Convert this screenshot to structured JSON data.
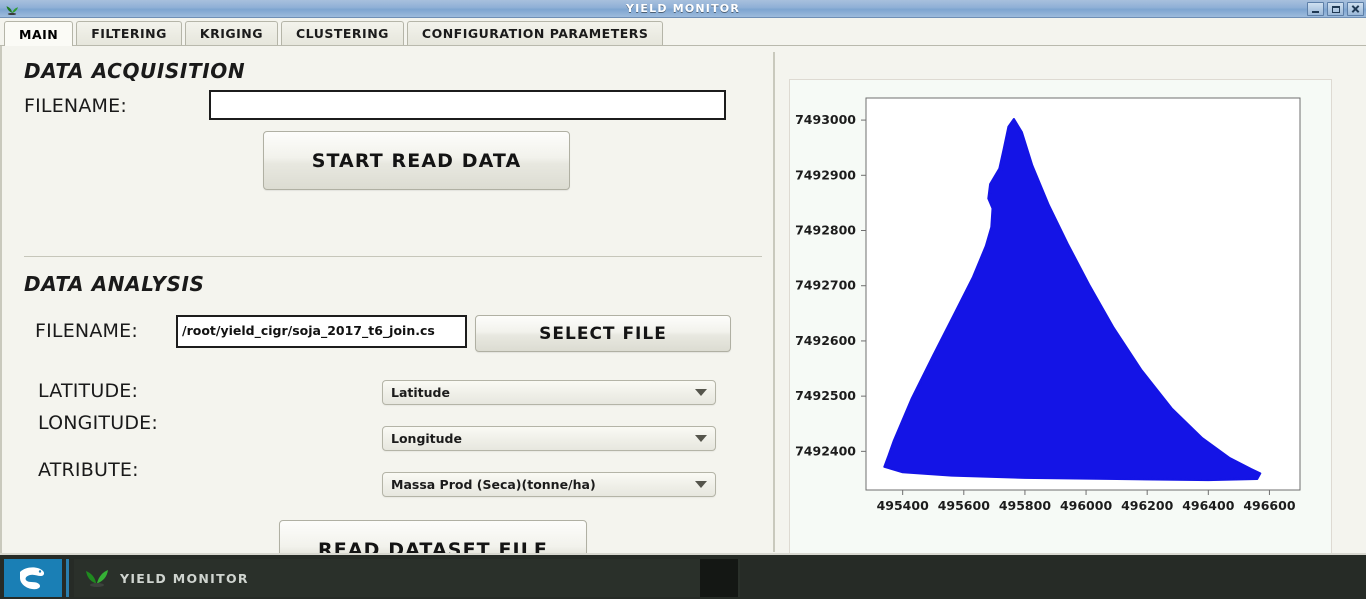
{
  "window": {
    "title": "YIELD MONITOR",
    "icon": "seedling-icon",
    "controls": [
      {
        "name": "minimize-button",
        "glyph": "minimize-icon"
      },
      {
        "name": "maximize-button",
        "glyph": "maximize-icon"
      },
      {
        "name": "close-button",
        "glyph": "close-icon"
      }
    ]
  },
  "tabs": [
    {
      "label": "MAIN",
      "active": true
    },
    {
      "label": "FILTERING",
      "active": false
    },
    {
      "label": "KRIGING",
      "active": false
    },
    {
      "label": "CLUSTERING",
      "active": false
    },
    {
      "label": "CONFIGURATION PARAMETERS",
      "active": false
    }
  ],
  "data_acquisition": {
    "heading": "DATA ACQUISITION",
    "filename_label": "FILENAME:",
    "filename_value": "",
    "filename_placeholder": "",
    "start_button": "START READ DATA"
  },
  "data_analysis": {
    "heading": "DATA ANALYSIS",
    "filename_label": "FILENAME:",
    "filename_value": "/root/yield_cigr/soja_2017_t6_join.cs",
    "select_file_button": "SELECT FILE",
    "latitude_label": "LATITUDE:",
    "latitude_value": "Latitude",
    "longitude_label": "LONGITUDE:",
    "longitude_value": "Longitude",
    "atribute_label": "ATRIBUTE:",
    "atribute_value": "Massa Prod (Seca)(tonne/ha)",
    "read_button": "READ DATASET FILE"
  },
  "chart_data": {
    "type": "scatter",
    "title": "",
    "xlabel": "",
    "ylabel": "",
    "xlim": [
      495280,
      496700
    ],
    "ylim": [
      7492330,
      7493040
    ],
    "xticks": [
      495400,
      495600,
      495800,
      496000,
      496200,
      496400,
      496600
    ],
    "yticks": [
      7492400,
      7492500,
      7492600,
      7492700,
      7492800,
      7492900,
      7493000
    ],
    "grid": false,
    "legend": null,
    "point_color": "#1414e6",
    "series": [
      {
        "name": "Massa Prod (Seca)(tonne/ha)",
        "description": "Dense point cloud of harvester yield samples forming the field boundary: a broad triangular plot with a peak near x=495790 and a notch on its upper-left flank.",
        "boundary": [
          [
            495352,
            7492390
          ],
          [
            495370,
            7492418
          ],
          [
            495430,
            7492496
          ],
          [
            495500,
            7492574
          ],
          [
            495570,
            7492650
          ],
          [
            495630,
            7492716
          ],
          [
            495672,
            7492772
          ],
          [
            495690,
            7492806
          ],
          [
            495694,
            7492840
          ],
          [
            495680,
            7492858
          ],
          [
            495686,
            7492884
          ],
          [
            495716,
            7492912
          ],
          [
            495730,
            7492946
          ],
          [
            495746,
            7492988
          ],
          [
            495764,
            7493002
          ],
          [
            495790,
            7492978
          ],
          [
            495824,
            7492918
          ],
          [
            495878,
            7492846
          ],
          [
            495940,
            7492776
          ],
          [
            496010,
            7492702
          ],
          [
            496090,
            7492624
          ],
          [
            496180,
            7492548
          ],
          [
            496280,
            7492478
          ],
          [
            496380,
            7492424
          ],
          [
            496470,
            7492388
          ],
          [
            496540,
            7492368
          ],
          [
            496570,
            7492360
          ],
          [
            496560,
            7492350
          ],
          [
            496400,
            7492348
          ],
          [
            496100,
            7492350
          ],
          [
            495800,
            7492352
          ],
          [
            495560,
            7492356
          ],
          [
            495400,
            7492362
          ],
          [
            495340,
            7492372
          ]
        ]
      }
    ]
  },
  "taskbar": {
    "start_icon": "bird-logo-icon",
    "task_icon": "plant-icon",
    "task_label": "YIELD MONITOR"
  },
  "colors": {
    "titlebar": "#8fb0d6",
    "window_bg": "#f4f4ee",
    "plot_points": "#1414e6",
    "taskbar": "#262b26",
    "start": "#1a7fb5"
  }
}
